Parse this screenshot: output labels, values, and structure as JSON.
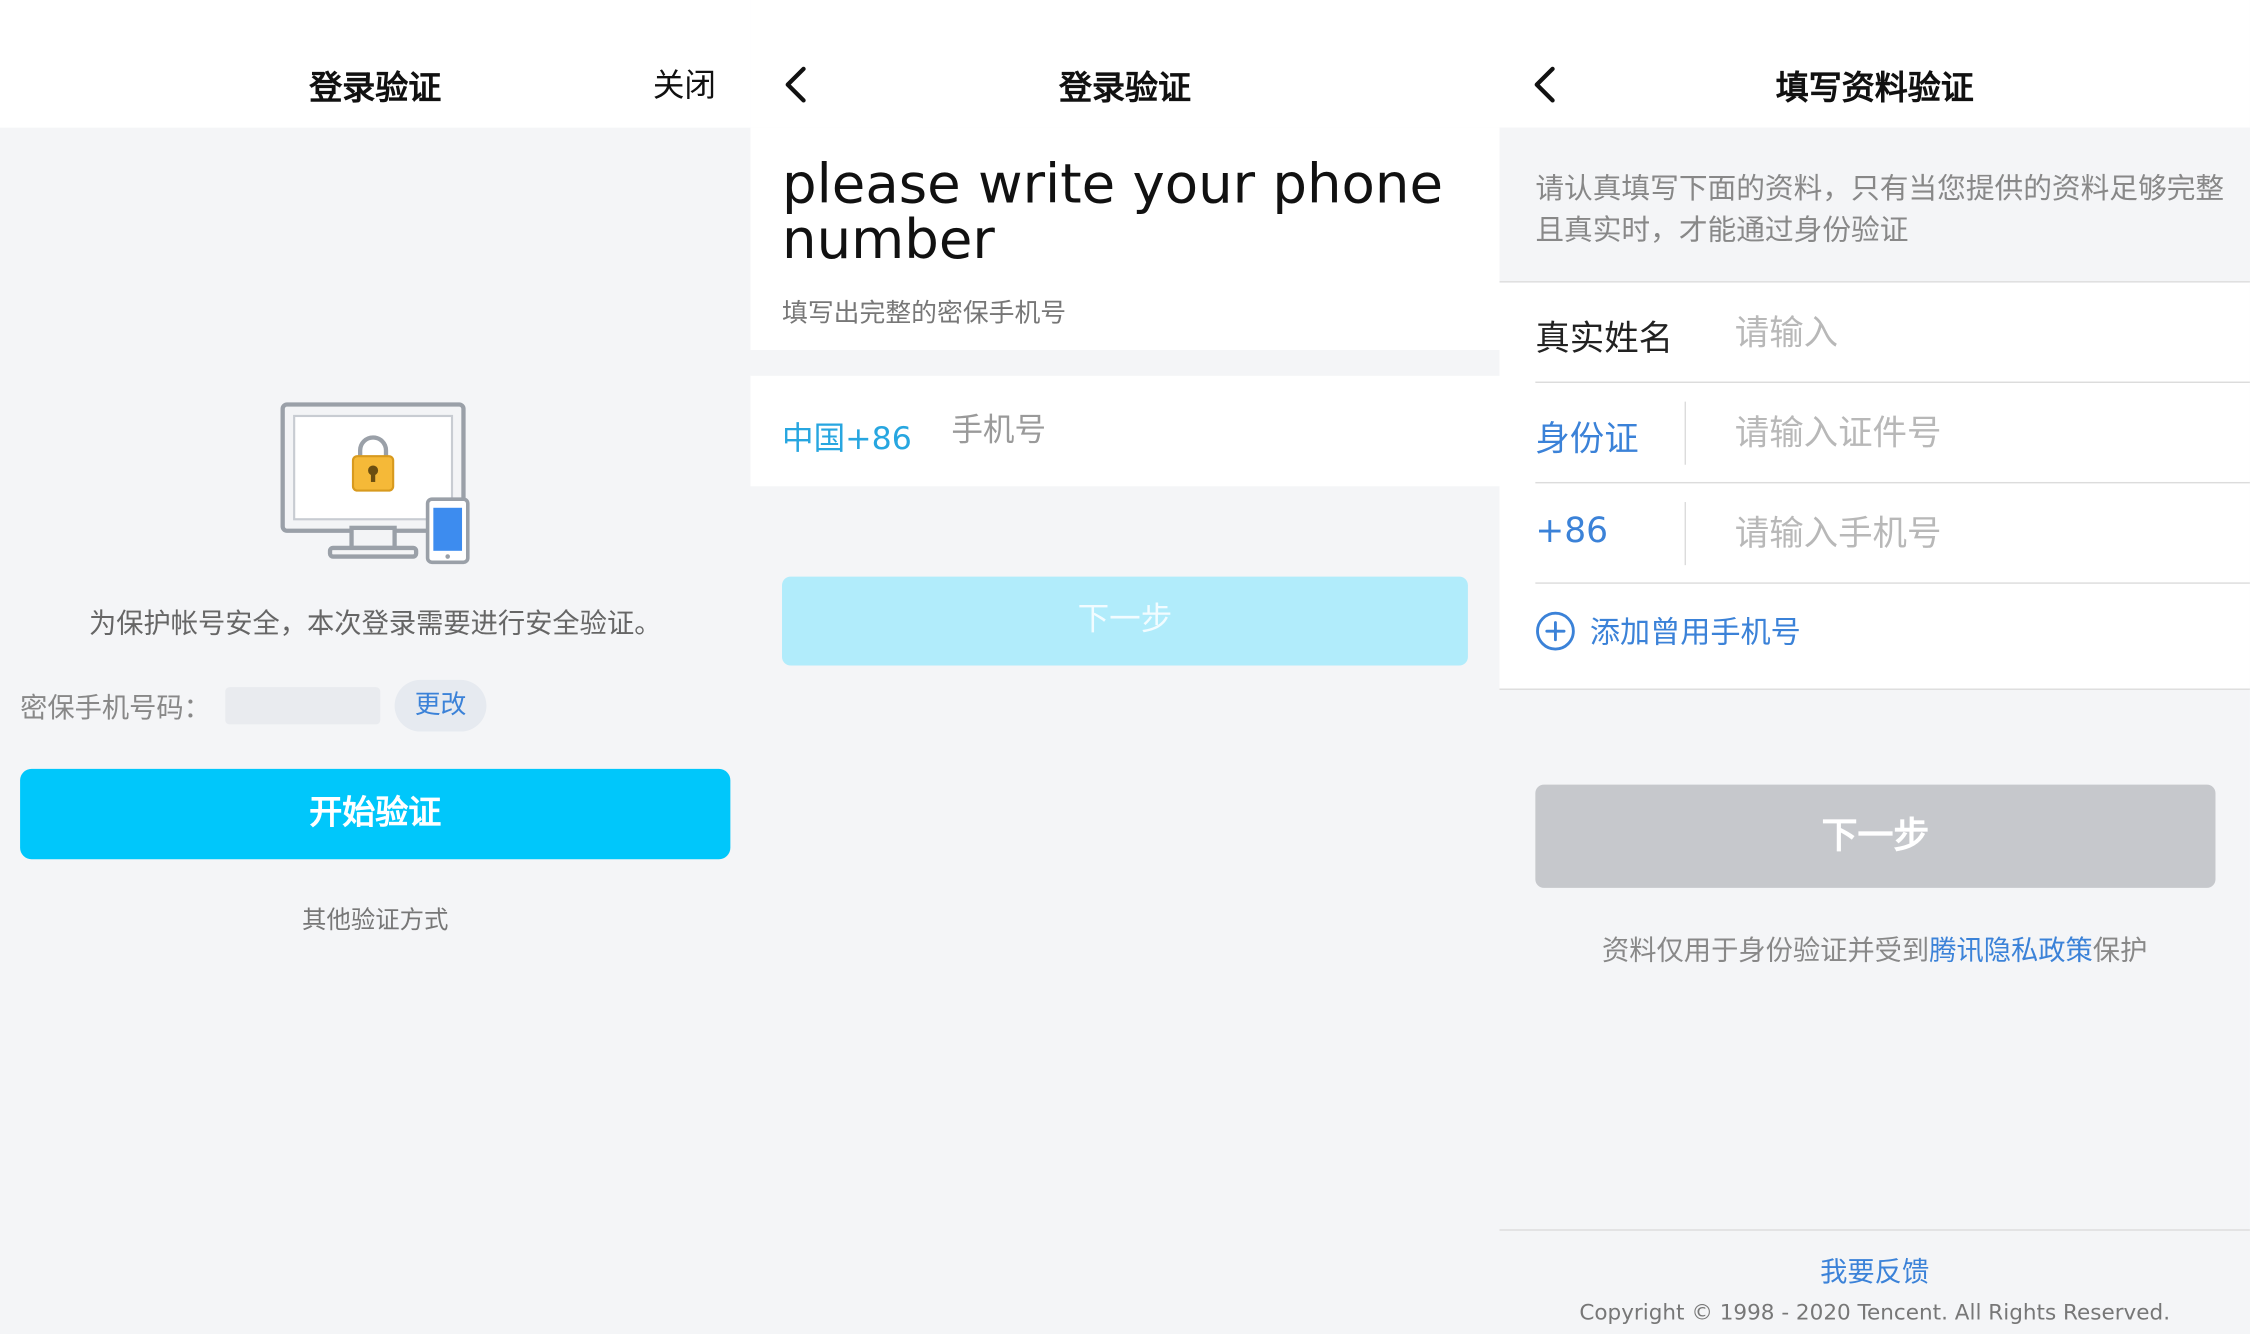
{
  "screen1": {
    "title": "登录验证",
    "close_label": "关闭",
    "message": "为保护帐号安全，本次登录需要进行安全验证。",
    "phone_label": "密保手机号码：",
    "change_label": "更改",
    "start_button": "开始验证",
    "other_methods": "其他验证方式",
    "colors": {
      "primary": "#00c7fb",
      "link": "#3b82d8",
      "lock": "#f5b938"
    },
    "icons": [
      "computer-lock-illustration",
      "phone-icon"
    ]
  },
  "screen2": {
    "title": "登录验证",
    "heading": "please write your phone number",
    "subheading": "填写出完整的密保手机号",
    "country_code": "中国+86",
    "phone_placeholder": "手机号",
    "next_button": "下一步",
    "colors": {
      "country": "#27a6e0",
      "button_disabled": "#b1ecfb"
    },
    "icons": [
      "back-chevron-icon"
    ]
  },
  "screen3": {
    "title": "填写资料验证",
    "notice": "请认真填写下面的资料，只有当您提供的资料足够完整且真实时，才能通过身份验证",
    "fields": {
      "name_label": "真实姓名",
      "name_placeholder": "请输入",
      "id_label": "身份证",
      "id_placeholder": "请输入证件号",
      "phone_label": "+86",
      "phone_placeholder": "请输入手机号"
    },
    "add_phone_label": "添加曾用手机号",
    "next_button": "下一步",
    "privacy_prefix": "资料仅用于身份验证并受到",
    "privacy_link": "腾讯隐私政策",
    "privacy_suffix": "保护",
    "feedback_label": "我要反馈",
    "copyright": "Copyright © 1998 - 2020 Tencent. All Rights Reserved.",
    "colors": {
      "link": "#3b82d8",
      "button_disabled": "#c6c8cc"
    },
    "icons": [
      "back-chevron-icon",
      "plus-circle-icon"
    ]
  }
}
